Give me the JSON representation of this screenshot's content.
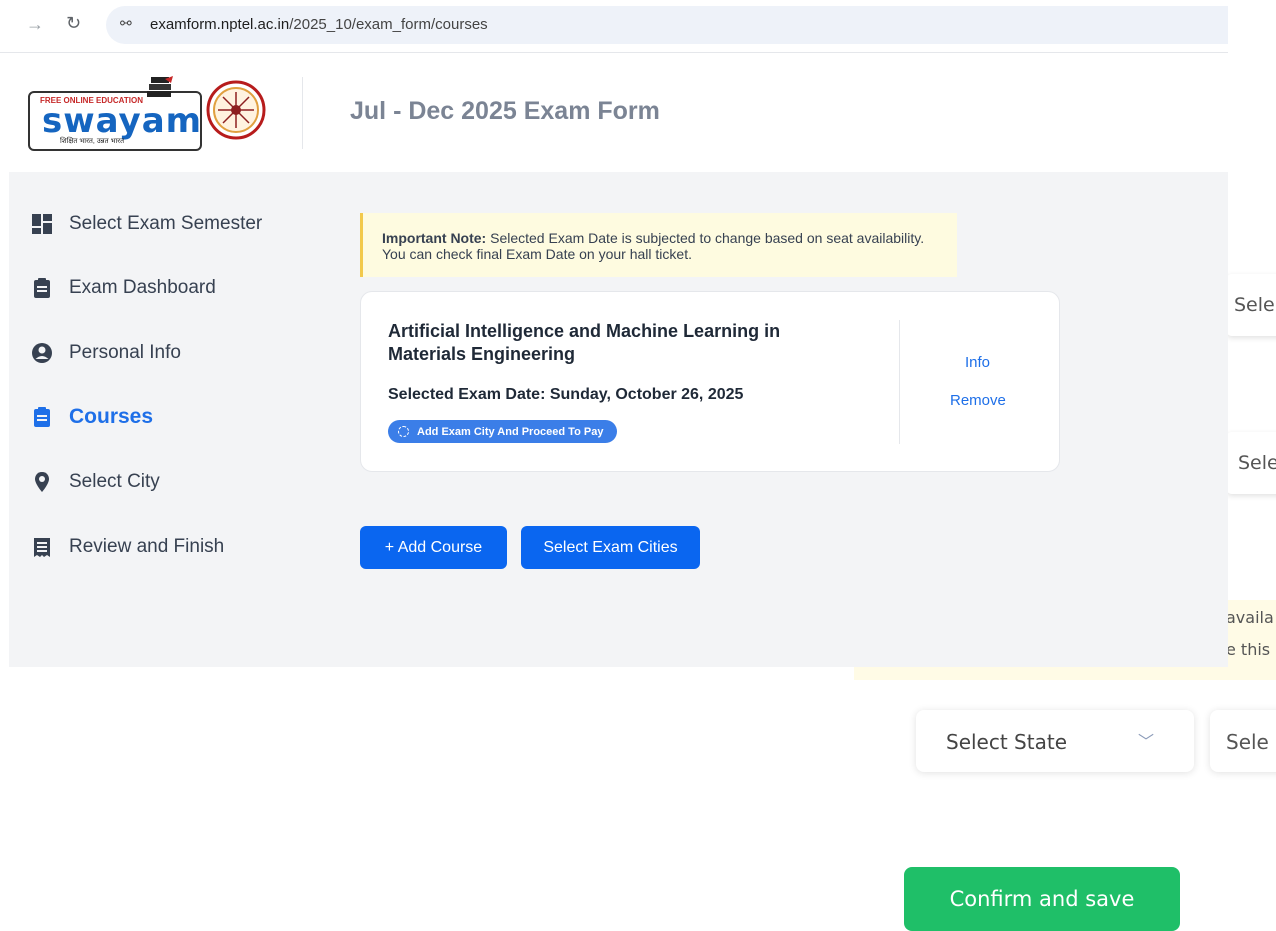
{
  "browser": {
    "url_host": "examform.nptel.ac.in",
    "url_path": "/2025_10/exam_form/courses"
  },
  "header": {
    "logo_tagline_top": "FREE ONLINE EDUCATION",
    "logo_text": "swayam",
    "logo_tagline_bottom": "शिक्षित भारत, उन्नत भारत",
    "title": "Jul - Dec 2025 Exam Form"
  },
  "sidebar": {
    "items": [
      {
        "label": "Select Exam Semester",
        "icon": "dashboard-icon"
      },
      {
        "label": "Exam Dashboard",
        "icon": "clipboard-icon"
      },
      {
        "label": "Personal Info",
        "icon": "user-circle-icon"
      },
      {
        "label": "Courses",
        "icon": "clipboard-icon",
        "active": true
      },
      {
        "label": "Select City",
        "icon": "location-pin-icon"
      },
      {
        "label": "Review and Finish",
        "icon": "receipt-icon"
      }
    ]
  },
  "note": {
    "label": "Important Note:",
    "text": " Selected Exam Date is subjected to change based on seat availability. You can check final Exam Date on your hall ticket."
  },
  "course": {
    "title": "Artificial Intelligence and Machine Learning in Materials Engineering",
    "exam_date": "Selected Exam Date: Sunday, October 26, 2025",
    "badge": "Add Exam City And Proceed To Pay",
    "info_link": "Info",
    "remove_link": "Remove"
  },
  "actions": {
    "add_course": "+  Add Course",
    "select_cities": "Select Exam Cities"
  },
  "background": {
    "select_partial_1": "Sele",
    "select_partial_2": "Sele",
    "avail_partial": "availa",
    "this_partial": "e this",
    "select_state": "Select State",
    "select_partial_3": "Sele",
    "confirm": "Confirm and save"
  },
  "colors": {
    "primary": "#0a66f0",
    "active_nav": "#1e6fe8",
    "confirm_green": "#1fbf68",
    "note_bg": "#fefbe0"
  }
}
